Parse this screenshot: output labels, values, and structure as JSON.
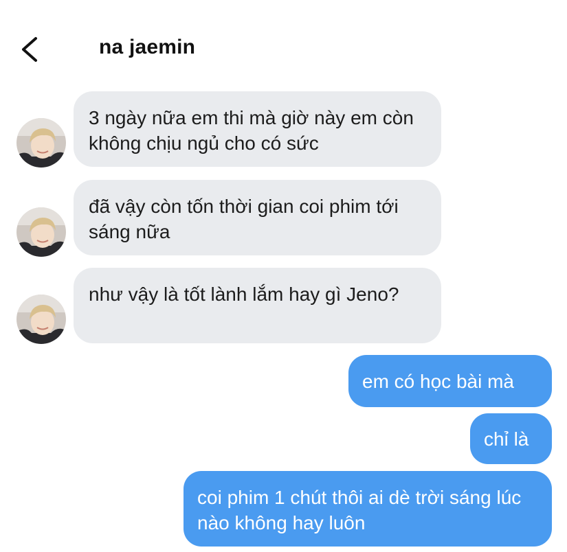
{
  "header": {
    "contact_name": "na jaemin",
    "back_icon": "chevron-left-icon"
  },
  "messages": [
    {
      "from": "contact",
      "text": "3 ngày nữa em thi mà giờ này em còn không chịu ngủ cho có sức"
    },
    {
      "from": "contact",
      "text": "đã vậy còn tốn thời gian coi phim tới sáng nữa"
    },
    {
      "from": "contact",
      "text": "như vậy là tốt lành lắm hay gì Jeno?"
    },
    {
      "from": "me",
      "text": "em có học bài mà"
    },
    {
      "from": "me",
      "text": "chỉ là"
    },
    {
      "from": "me",
      "text": "coi phim 1 chút thôi ai dè trời sáng lúc nào không hay luôn"
    }
  ],
  "colors": {
    "incoming_bubble": "#e9ebee",
    "outgoing_bubble": "#4a9bf0",
    "outgoing_text": "#ffffff"
  }
}
